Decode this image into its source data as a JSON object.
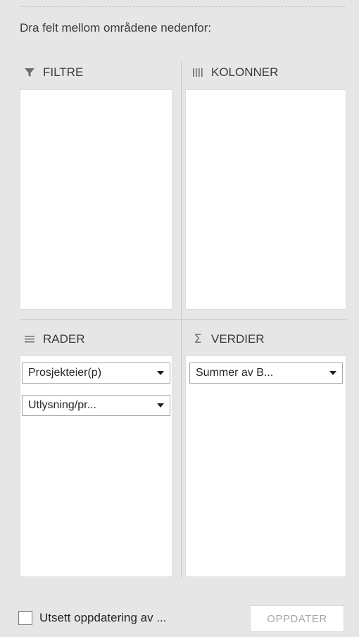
{
  "instruction": "Dra felt mellom områdene nedenfor:",
  "areas": {
    "filters": {
      "label": "FILTRE",
      "icon": "filter-icon",
      "fields": []
    },
    "columns": {
      "label": "KOLONNER",
      "icon": "columns-icon",
      "fields": []
    },
    "rows": {
      "label": "RADER",
      "icon": "rows-icon",
      "fields": [
        "Prosjekteier(p)",
        "Utlysning/pr..."
      ]
    },
    "values": {
      "label": "VERDIER",
      "icon": "sigma-icon",
      "fields": [
        "Summer av B..."
      ]
    }
  },
  "footer": {
    "defer_label": "Utsett oppdatering av ...",
    "defer_checked": false,
    "update_label": "OPPDATER",
    "update_enabled": false
  }
}
